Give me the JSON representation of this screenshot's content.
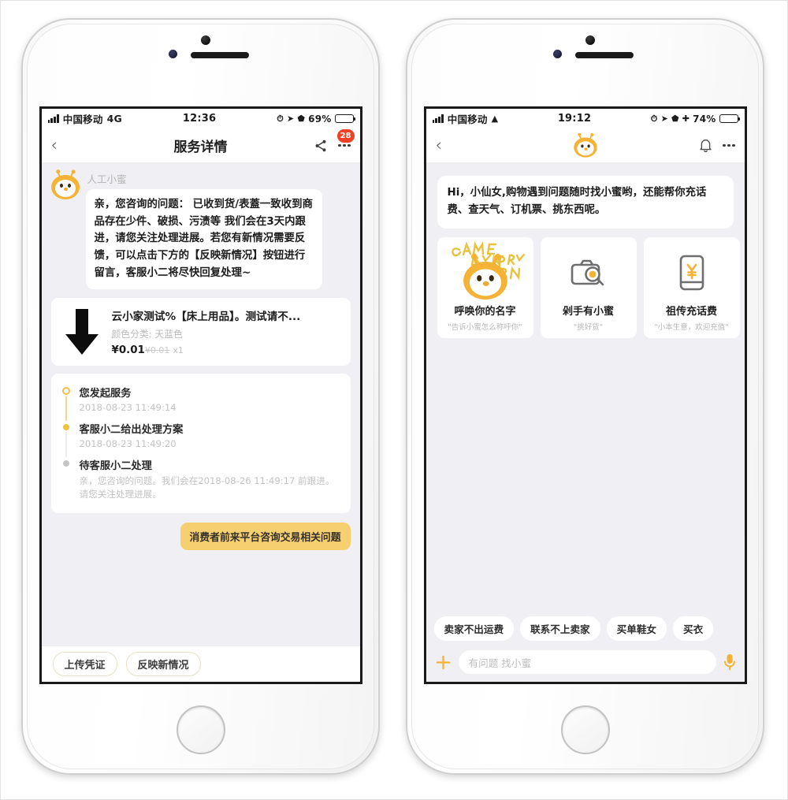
{
  "left_phone": {
    "status_bar": {
      "carrier": "中国移动",
      "network": "4G",
      "time": "12:36",
      "battery_percent": "69%",
      "icons": [
        "signal-bars-icon",
        "location-arrow-icon",
        "alarm-icon",
        "battery-icon"
      ]
    },
    "nav": {
      "back_label": "‹",
      "title": "服务详情",
      "share_icon": "share-icon",
      "more_icon": "more-dots-icon",
      "badge_count": "28"
    },
    "agent": {
      "name": "人工小蜜",
      "message": "亲，您咨询的问题： 已收到货/表蓋一致收到商品存在少件、破损、污渍等 我们会在3天内跟进，请您关注处理进展。若您有新情况需要反馈，可以点击下方的【反映新情况】按钮进行留言，客服小二将尽快回复处理~"
    },
    "product": {
      "image_icon": "down-arrow-icon",
      "title": "云小家测试%【床上用品】。测试请不...",
      "sku": "颜色分类: 天蓝色",
      "price": "¥0.01",
      "original_price": "¥0.01",
      "quantity": "x1"
    },
    "timeline": [
      {
        "title": "您发起服务",
        "time": "2018-08-23 11:49:14",
        "desc": "",
        "state": "done"
      },
      {
        "title": "客服小二给出处理方案",
        "time": "2018-08-23 11:49:20",
        "desc": "",
        "state": "done"
      },
      {
        "title": "待客服小二处理",
        "time": "",
        "desc": "亲，您咨询的问题。我们会在2018-08-26 11:49:17 前跟进。请您关注处理进展。",
        "state": "pending"
      }
    ],
    "system_message": "消费者前来平台咨询交易相关问题",
    "actions": [
      {
        "label": "上传凭证"
      },
      {
        "label": "反映新情况"
      }
    ]
  },
  "right_phone": {
    "status_bar": {
      "carrier": "中国移动",
      "network": "wifi-icon",
      "time": "19:12",
      "battery_percent": "74%",
      "icons": [
        "signal-bars-icon",
        "location-arrow-icon",
        "alarm-icon",
        "bluetooth-icon",
        "battery-icon"
      ]
    },
    "nav": {
      "back_label": "‹",
      "logo_icon": "bee-mascot-icon",
      "bell_icon": "bell-icon",
      "more_icon": "more-dots-icon"
    },
    "greeting": "Hi，小仙女,购物遇到问题随时找小蜜哟，还能帮你充话费、查天气、订机票、挑东西呢。",
    "cards": [
      {
        "title": "呼唤你的名字",
        "sub": "\"告诉小蜜怎么称呼你\"",
        "icon": "bee-mascot-icon",
        "handwriting": "CALL ME BY YOUR NAME"
      },
      {
        "title": "剁手有小蜜",
        "sub": "\"挑好货\"",
        "icon": "camera-icon"
      },
      {
        "title": "祖传充话费",
        "sub": "\"小本生意，欢迎充值\"",
        "icon": "phone-recharge-icon"
      }
    ],
    "chips": [
      "卖家不出运费",
      "联系不上卖家",
      "买单鞋女",
      "买衣"
    ],
    "input": {
      "add_icon": "plus-icon",
      "placeholder": "有问题 找小蜜",
      "mic_icon": "microphone-icon"
    }
  },
  "colors": {
    "accent_yellow": "#f5b335",
    "bubble_yellow": "#f6cf71",
    "badge_red": "#ef4123",
    "chat_bg": "#f0f0f4",
    "battery_green": "#49cf5a"
  }
}
